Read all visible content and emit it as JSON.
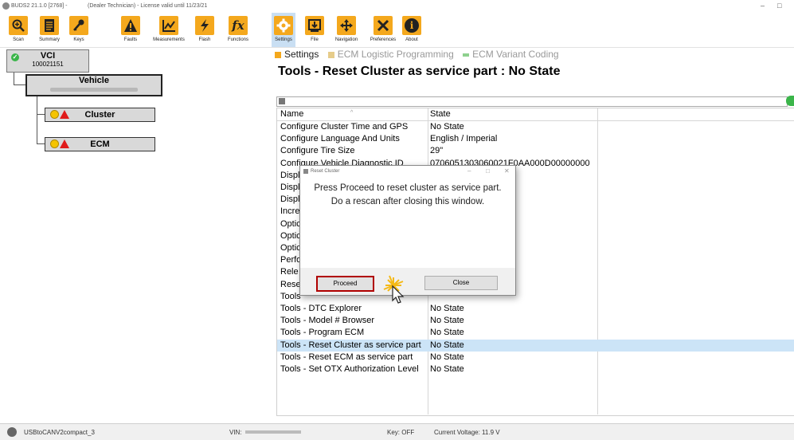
{
  "window": {
    "title": "BUDS2 21.1.0 [2768] -",
    "license": "(Dealer Technician) - License valid until 11/23/21",
    "min_glyph": "–",
    "max_glyph": "□"
  },
  "toolbar": {
    "items": [
      {
        "label": "Scan",
        "icon": "magnifier-icon"
      },
      {
        "label": "Summary",
        "icon": "document-icon"
      },
      {
        "label": "Keys",
        "icon": "key-icon"
      },
      {
        "label": "Faults",
        "icon": "warning-icon"
      },
      {
        "label": "Measurements",
        "icon": "chart-icon"
      },
      {
        "label": "Flash",
        "icon": "flash-icon"
      },
      {
        "label": "Functions",
        "icon": "fx-icon"
      },
      {
        "label": "Settings",
        "icon": "gear-icon"
      },
      {
        "label": "File",
        "icon": "download-icon"
      },
      {
        "label": "Navigation",
        "icon": "arrows-icon"
      },
      {
        "label": "Preferences",
        "icon": "tools-icon"
      },
      {
        "label": "About",
        "icon": "info-icon"
      }
    ],
    "active": "Settings",
    "fx_glyph": "fx",
    "info_glyph": "i"
  },
  "tree": {
    "vci": {
      "name": "VCI",
      "id": "100021151",
      "check": "✓"
    },
    "vehicle": {
      "name": "Vehicle"
    },
    "cluster": {
      "name": "Cluster"
    },
    "ecm": {
      "name": "ECM"
    }
  },
  "tabs": [
    {
      "label": "Settings",
      "active": true
    },
    {
      "label": "ECM Logistic Programming",
      "active": false
    },
    {
      "label": "ECM Variant Coding",
      "active": false
    }
  ],
  "page_title": "Tools - Reset Cluster as service part : No State",
  "table": {
    "columns": [
      "Name",
      "State"
    ],
    "sort_caret": "^",
    "rows": [
      {
        "name": "Configure Cluster Time and GPS",
        "state": "No State"
      },
      {
        "name": "Configure Language And Units",
        "state": "English / Imperial"
      },
      {
        "name": "Configure Tire Size",
        "state": "29\""
      },
      {
        "name": "Configure Vehicle Diagnostic ID",
        "state": "0706051303060021F0AA000D00000000"
      },
      {
        "name": "Displ",
        "state": ""
      },
      {
        "name": "Displ",
        "state": ""
      },
      {
        "name": "Displ",
        "state": ""
      },
      {
        "name": "Incre",
        "state": ""
      },
      {
        "name": "Optic",
        "state": ""
      },
      {
        "name": "Optic",
        "state": ""
      },
      {
        "name": "Optic",
        "state": ""
      },
      {
        "name": "Perfo",
        "state": ""
      },
      {
        "name": "Rele",
        "state": ""
      },
      {
        "name": "Rese",
        "state": ""
      },
      {
        "name": "Tools",
        "state": ""
      },
      {
        "name": "Tools - DTC Explorer",
        "state": "No State"
      },
      {
        "name": "Tools - Model # Browser",
        "state": "No State"
      },
      {
        "name": "Tools - Program ECM",
        "state": "No State"
      },
      {
        "name": "Tools - Reset Cluster as service part",
        "state": "No State",
        "selected": true
      },
      {
        "name": "Tools - Reset ECM as service part",
        "state": "No State"
      },
      {
        "name": "Tools - Set OTX Authorization Level",
        "state": "No State"
      }
    ]
  },
  "dialog": {
    "title": "Reset Cluster",
    "message_line1": "Press Proceed to reset cluster as service part.",
    "message_line2": "Do a rescan after closing this window.",
    "proceed_label": "Proceed",
    "close_label": "Close",
    "min_glyph": "–",
    "max_glyph": "□",
    "close_glyph": "✕"
  },
  "statusbar": {
    "adapter": "USBtoCANV2compact_3",
    "vin_label": "VIN:",
    "key": "Key: OFF",
    "voltage": "Current Voltage: 11.9 V"
  },
  "colors": {
    "icon_orange": "#f4a81d",
    "selected_row": "#cce4f7",
    "active_tab": "#c9dff3",
    "warning_red": "#e01b1b",
    "ok_green": "#3bb54a",
    "highlight_border": "#b00000"
  }
}
